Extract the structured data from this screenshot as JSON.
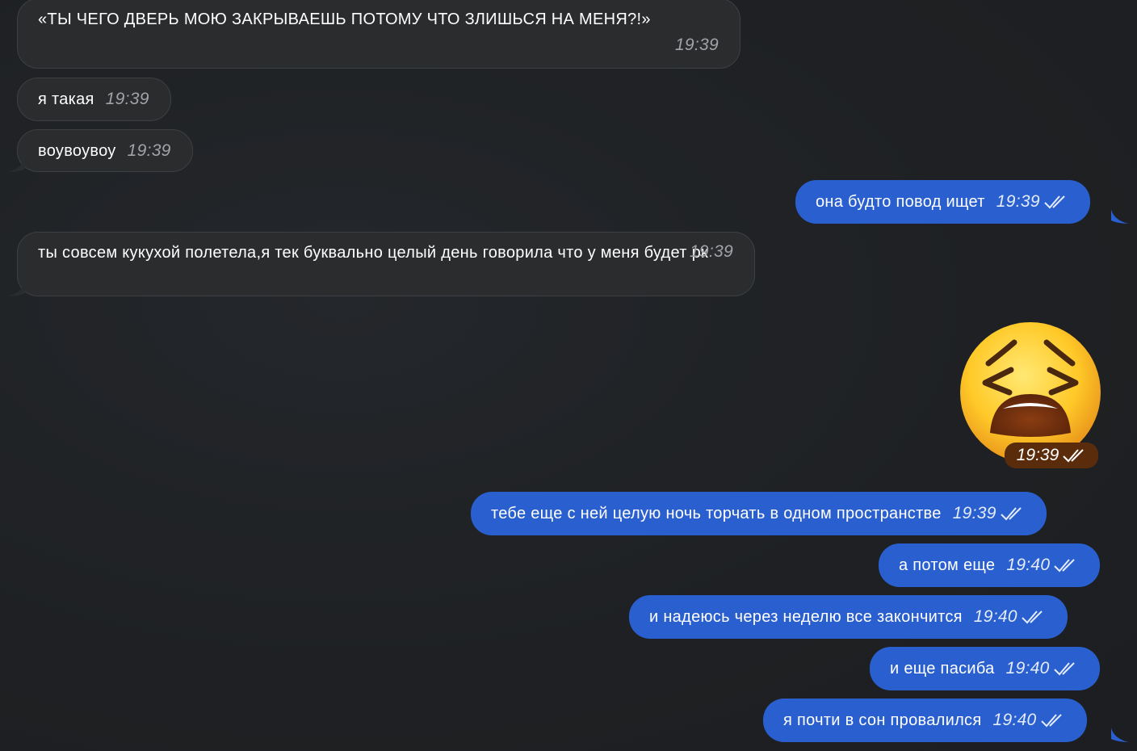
{
  "messages": [
    {
      "id": "m1",
      "dir": "in",
      "text": "«ТЫ ЧЕГО ДВЕРЬ МОЮ ЗАКРЫВАЕШЬ ПОТОМУ ЧТО ЗЛИШЬСЯ НА МЕНЯ?!»",
      "time": "19:39"
    },
    {
      "id": "m2",
      "dir": "in",
      "text": "я такая",
      "time": "19:39"
    },
    {
      "id": "m3",
      "dir": "in",
      "text": "воувоувоу",
      "time": "19:39"
    },
    {
      "id": "m4",
      "dir": "out",
      "text": "она будто повод ищет",
      "time": "19:39",
      "status": "read"
    },
    {
      "id": "m5",
      "dir": "in",
      "text": "ты совсем кукухой полетела,я тек буквально целый день говорила что у меня будет рк",
      "time": "19:39"
    },
    {
      "id": "m6",
      "dir": "out",
      "sticker": "weary-face-emoji",
      "time": "19:39",
      "status": "read"
    },
    {
      "id": "m7",
      "dir": "out",
      "text": "тебе еще с ней целую ночь торчать в одном пространстве",
      "time": "19:39",
      "status": "read"
    },
    {
      "id": "m8",
      "dir": "out",
      "text": "а потом еще",
      "time": "19:40",
      "status": "read"
    },
    {
      "id": "m9",
      "dir": "out",
      "text": "и надеюсь через неделю все закончится",
      "time": "19:40",
      "status": "read"
    },
    {
      "id": "m10",
      "dir": "out",
      "text": "и еще пасиба",
      "time": "19:40",
      "status": "read"
    },
    {
      "id": "m11",
      "dir": "out",
      "text": "я почти в сон провалился",
      "time": "19:40",
      "status": "read"
    }
  ],
  "colors": {
    "background": "#1f2124",
    "incoming_bubble": "#2b2c2e",
    "outgoing_bubble": "#2a5fcf"
  }
}
